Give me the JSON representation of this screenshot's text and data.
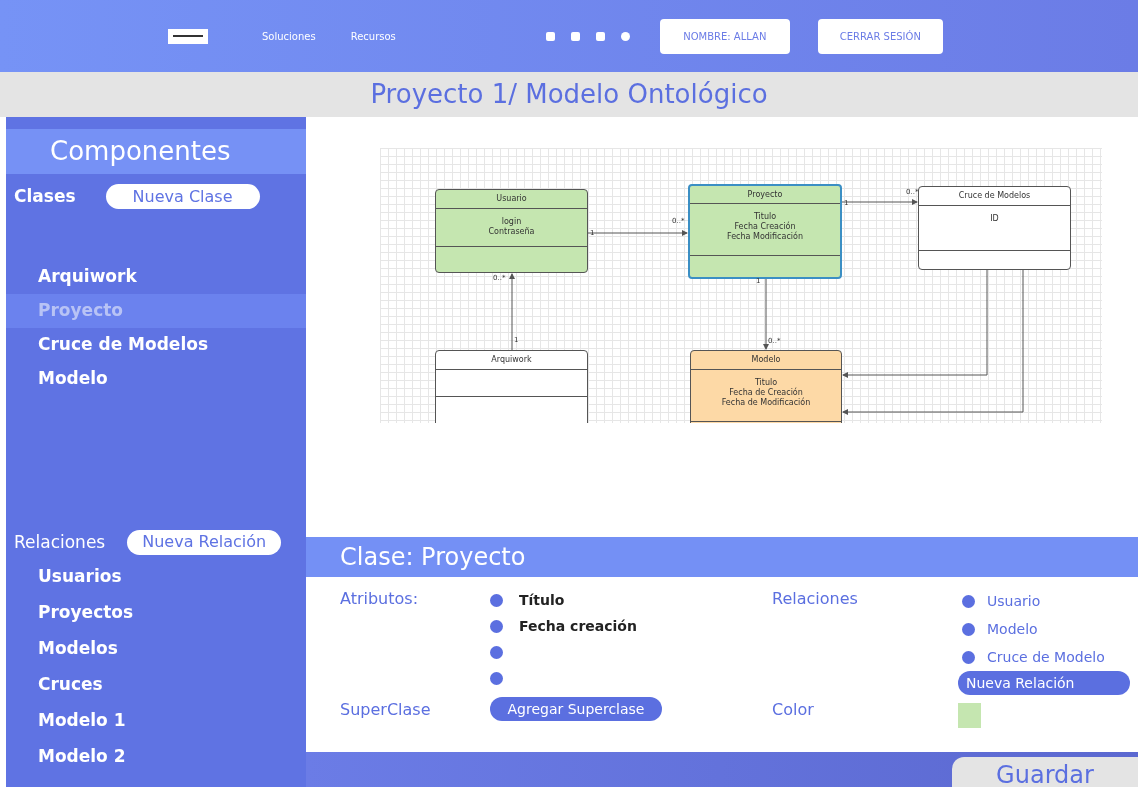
{
  "nav": {
    "links": [
      "Soluciones",
      "Recursos"
    ],
    "user_button": "NOMBRE: ALLAN",
    "logout_button": "CERRAR SESIÓN"
  },
  "page_title": "Proyecto 1/ Modelo Ontológico",
  "sidebar": {
    "title": "Componentes",
    "classes_label": "Clases",
    "new_class_button": "Nueva Clase",
    "classes": [
      {
        "label": "Arquiwork",
        "selected": false
      },
      {
        "label": "Proyecto",
        "selected": true
      },
      {
        "label": "Cruce de Modelos",
        "selected": false
      },
      {
        "label": "Modelo",
        "selected": false
      }
    ],
    "relations_label": "Relaciones",
    "new_relation_button": "Nueva Relación",
    "relations": [
      "Usuarios",
      "Proyectos",
      "Modelos",
      "Cruces",
      "Modelo 1",
      "Modelo 2"
    ]
  },
  "diagram": {
    "classes": [
      {
        "name": "Usuario",
        "attributes": [
          "login",
          "Contraseña"
        ],
        "color": "#c5e6b0",
        "selected": false
      },
      {
        "name": "Proyecto",
        "attributes": [
          "Titulo",
          "Fecha Creación",
          "Fecha Modificación"
        ],
        "color": "#c5e6b0",
        "selected": true
      },
      {
        "name": "Cruce de Modelos",
        "attributes": [
          "ID"
        ],
        "color": "#ffffff",
        "selected": false
      },
      {
        "name": "Arquiwork",
        "color": "#ffffff",
        "selected": false
      },
      {
        "name": "Modelo",
        "attributes": [
          "Titulo",
          "Fecha de Creación",
          "Fecha de Modificación"
        ],
        "color": "#fdd9a6",
        "selected": false
      }
    ],
    "multiplicities": [
      "1",
      "0..*",
      "1",
      "0..*",
      "1",
      "0..*",
      "0..*",
      "1"
    ]
  },
  "detail": {
    "title": "Clase: Proyecto",
    "attributes_label": "Atributos:",
    "attributes": [
      {
        "kind": "filled",
        "text": "Título"
      },
      {
        "kind": "filled",
        "text": "Fecha creación"
      },
      {
        "kind": "empty"
      },
      {
        "kind": "empty"
      }
    ],
    "relations_label": "Relaciones",
    "relations": [
      "Usuario",
      "Modelo",
      "Cruce de Modelo"
    ],
    "new_relation_button": "Nueva Relación",
    "superclass_label": "SuperClase",
    "superclass_button": "Agregar Superclase",
    "color_label": "Color",
    "color": "#c5e6b0"
  },
  "save_button": "Guardar"
}
